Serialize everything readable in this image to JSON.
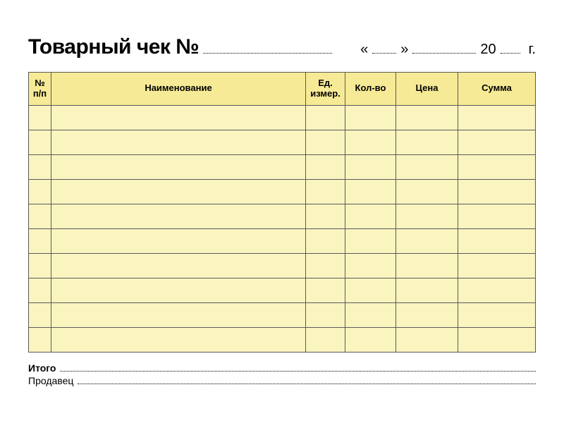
{
  "title": "Товарный чек №",
  "date": {
    "open_quote": "«",
    "close_quote": "»",
    "century": "20",
    "year_suffix": "г."
  },
  "columns": {
    "num": "№\nп/п",
    "name": "Наименование",
    "unit": "Ед.\nизмер.",
    "qty": "Кол-во",
    "price": "Цена",
    "sum": "Сумма"
  },
  "row_count": 10,
  "footer": {
    "total_label": "Итого",
    "seller_label": "Продавец"
  }
}
